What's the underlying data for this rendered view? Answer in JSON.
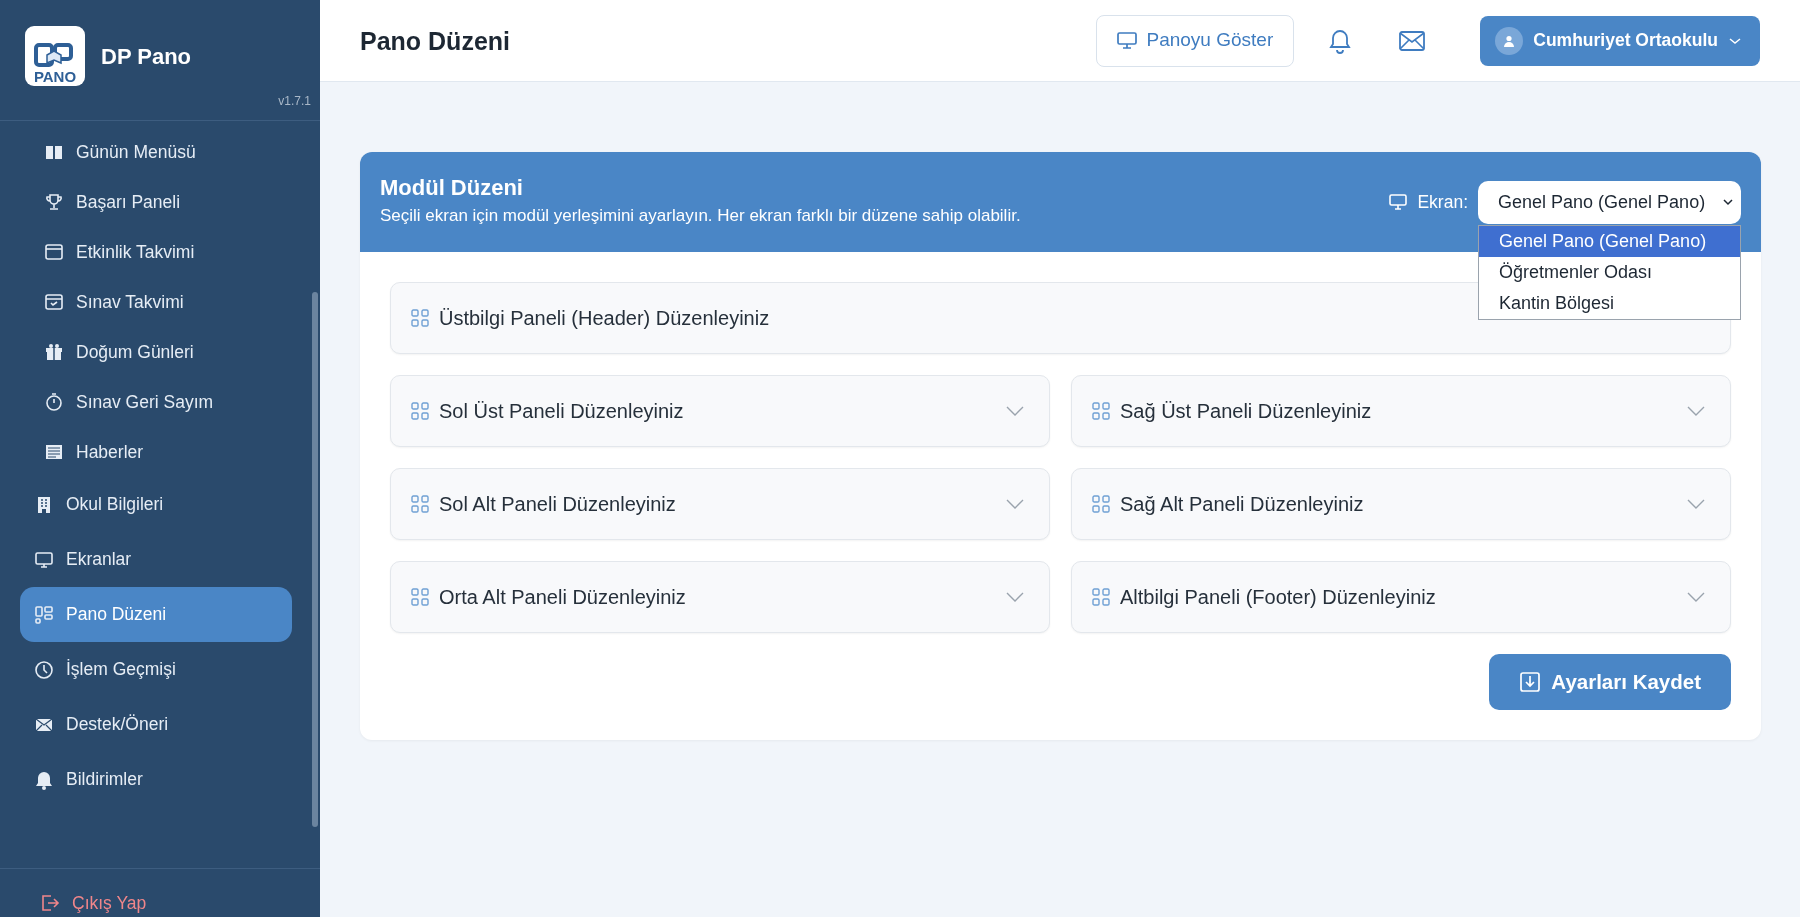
{
  "sidebar": {
    "brand": {
      "logo_text": "PANO",
      "name": "DP Pano",
      "version": "v1.7.1"
    },
    "items": [
      {
        "label": "Günün Menüsü",
        "kind": "subitem",
        "selected": false
      },
      {
        "label": "Başarı Paneli",
        "kind": "subitem",
        "selected": false
      },
      {
        "label": "Etkinlik Takvimi",
        "kind": "subitem",
        "selected": false
      },
      {
        "label": "Sınav Takvimi",
        "kind": "subitem",
        "selected": false
      },
      {
        "label": "Doğum Günleri",
        "kind": "subitem",
        "selected": false
      },
      {
        "label": "Sınav Geri Sayım",
        "kind": "subitem",
        "selected": false
      },
      {
        "label": "Haberler",
        "kind": "subitem",
        "selected": false
      },
      {
        "label": "Okul Bilgileri",
        "kind": "item",
        "selected": false
      },
      {
        "label": "Ekranlar",
        "kind": "item",
        "selected": false
      },
      {
        "label": "Pano Düzeni",
        "kind": "item",
        "selected": true
      },
      {
        "label": "İşlem Geçmişi",
        "kind": "item",
        "selected": false
      },
      {
        "label": "Destek/Öneri",
        "kind": "item",
        "selected": false
      },
      {
        "label": "Bildirimler",
        "kind": "item",
        "selected": false
      }
    ],
    "logout": "Çıkış Yap"
  },
  "topbar": {
    "title": "Pano Düzeni",
    "show_button": "Panoyu Göster",
    "user": "Cumhuriyet Ortaokulu"
  },
  "card": {
    "title": "Modül Düzeni",
    "subtitle": "Seçili ekran için modül yerleşimini ayarlayın. Her ekran farklı bir düzene sahip olabilir.",
    "screen_label": "Ekran:",
    "screen_value": "Genel Pano (Genel Pano)",
    "screen_options": [
      {
        "label": "Genel Pano (Genel Pano)",
        "selected": true
      },
      {
        "label": "Öğretmenler Odası",
        "selected": false
      },
      {
        "label": "Kantin Bölgesi",
        "selected": false
      }
    ],
    "panel_rows": [
      [
        {
          "label": "Üstbilgi Paneli (Header) Düzenleyiniz"
        }
      ],
      [
        {
          "label": "Sol Üst Paneli Düzenleyiniz"
        },
        {
          "label": "Sağ Üst Paneli Düzenleyiniz"
        }
      ],
      [
        {
          "label": "Sol Alt Paneli Düzenleyiniz"
        },
        {
          "label": "Sağ Alt Paneli Düzenleyiniz"
        }
      ],
      [
        {
          "label": "Orta Alt Paneli Düzenleyiniz"
        },
        {
          "label": "Altbilgi Paneli (Footer) Düzenleyiniz"
        }
      ]
    ],
    "save_button": "Ayarları Kaydet"
  }
}
